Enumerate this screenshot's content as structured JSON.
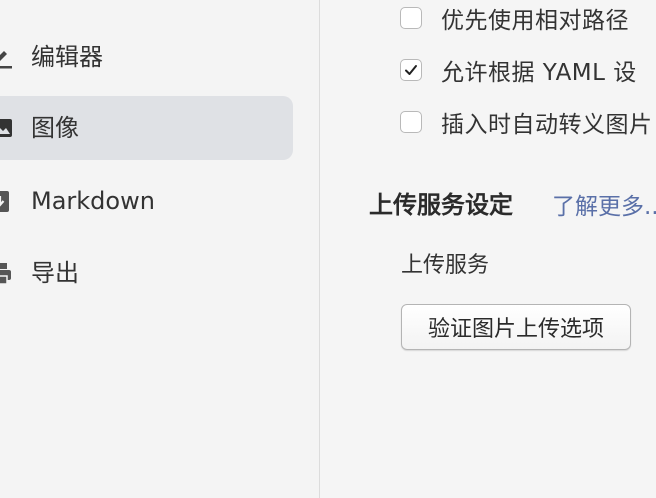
{
  "sidebar": {
    "items": [
      {
        "label": "编辑器",
        "icon": "editor-icon",
        "active": false
      },
      {
        "label": "图像",
        "icon": "image-icon",
        "active": true
      },
      {
        "label": "Markdown",
        "icon": "markdown-icon",
        "active": false
      },
      {
        "label": "导出",
        "icon": "export-icon",
        "active": false
      }
    ]
  },
  "main": {
    "options": [
      {
        "label": "优先使用相对路径",
        "checked": false
      },
      {
        "label": "允许根据 YAML 设",
        "checked": true
      },
      {
        "label": "插入时自动转义图片",
        "checked": false
      }
    ],
    "upload_section": {
      "title": "上传服务设定",
      "learn_more": "了解更多..."
    },
    "upload_service_label": "上传服务",
    "verify_button_label": "验证图片上传选项"
  },
  "colors": {
    "background": "#f5f5f5",
    "active_item": "#dfe1e5",
    "link": "#5a70a8",
    "text": "#333333"
  }
}
